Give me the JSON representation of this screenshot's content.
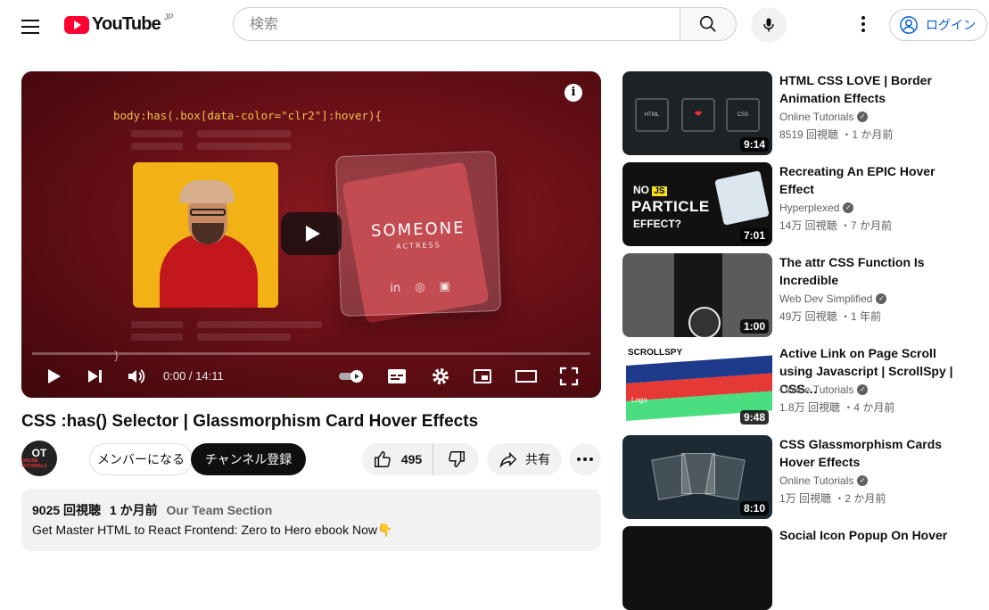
{
  "header": {
    "logo_text": "YouTube",
    "region": "JP",
    "search_placeholder": "検索",
    "login_label": "ログイン"
  },
  "player": {
    "code_line": "body:has(.box[data-color=\"clr2\"]:hover){",
    "code_close": "}",
    "card_title": "SOMEONE",
    "card_subtitle": "ACTRESS",
    "card_icons": [
      "linkedin-icon",
      "whatsapp-icon",
      "instagram-icon"
    ],
    "time_display": "0:00 / 14:11",
    "progress": 0.0
  },
  "video": {
    "title": "CSS :has() Selector | Glassmorphism Card Hover Effects",
    "channel_avatar_text": "OT",
    "channel_avatar_sub": "ONLINE TUTORIALS",
    "member_label": "メンバーになる",
    "subscribe_label": "チャンネル登録",
    "likes": "495",
    "share_label": "共有"
  },
  "description": {
    "views": "9025 回視聴",
    "date": "1 か月前",
    "team": "Our Team Section",
    "line": "Get Master HTML to React Frontend: Zero to Hero ebook Now👇"
  },
  "recommendations": [
    {
      "title": "HTML CSS LOVE | Border Animation Effects",
      "channel": "Online Tutorials",
      "stats": "8519 回視聴 ・1 か月前",
      "duration": "9:14"
    },
    {
      "title": "Recreating An EPIC Hover Effect",
      "channel": "Hyperplexed",
      "stats": "14万 回視聴 ・7 か月前",
      "duration": "7:01"
    },
    {
      "title": "The attr CSS Function Is Incredible",
      "channel": "Web Dev Simplified",
      "stats": "49万 回視聴 ・1 年前",
      "duration": "1:00"
    },
    {
      "title": "Active Link on Page Scroll using Javascript | ScrollSpy | CSS…",
      "channel": "Online Tutorials",
      "stats": "1.8万 回視聴 ・4 か月前",
      "duration": "9:48"
    },
    {
      "title": "CSS Glassmorphism Cards Hover Effects",
      "channel": "Online Tutorials",
      "stats": "1万 回視聴 ・2 か月前",
      "duration": "8:10"
    },
    {
      "title": "Social Icon Popup On Hover"
    }
  ],
  "thumb_text": {
    "t1_labels": [
      "HTML",
      "❤",
      "CSS"
    ],
    "t2_no": "NO",
    "t2_js": "JS",
    "t2_particle": "PARTICLE",
    "t2_effect": "EFFECT?",
    "t4_brand": "SCROLLSPY",
    "t4_logo": "Logo"
  },
  "colors": {
    "brand_red": "#ff0033",
    "link_blue": "#065fd4",
    "player_red": "#6a1017"
  }
}
